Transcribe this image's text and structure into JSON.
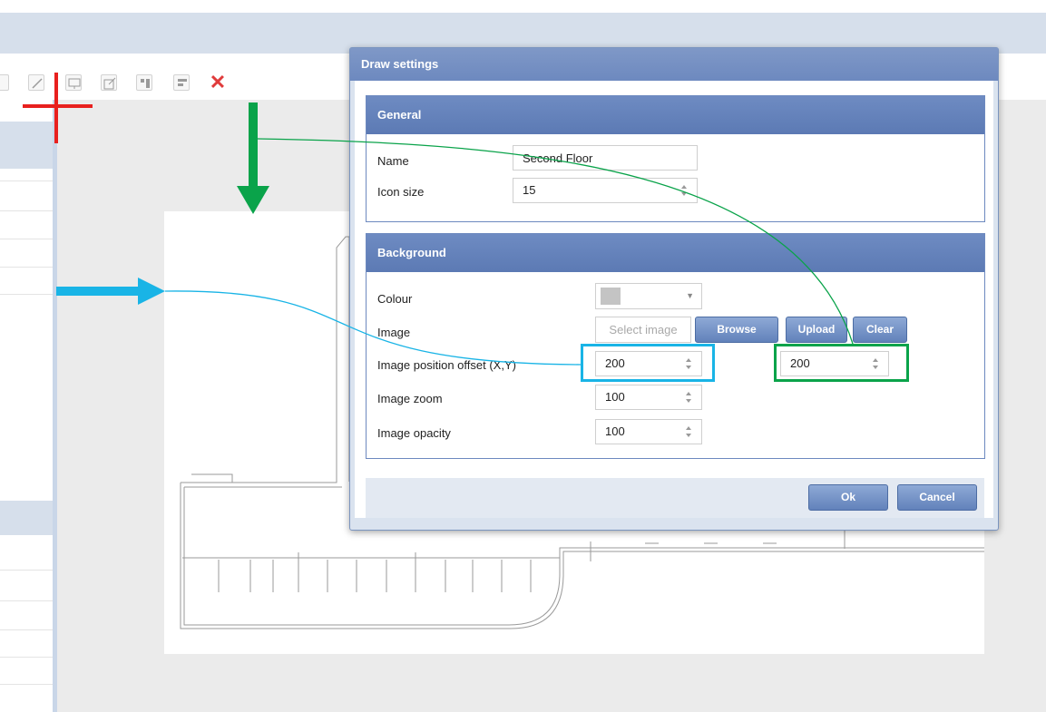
{
  "toolbar": {
    "icons": [
      "edit-line-icon",
      "monitor-icon",
      "edit-icon",
      "align-icon",
      "layout-icon",
      "delete-icon"
    ],
    "close_glyph": "✕",
    "close_color": "#e03b3b"
  },
  "dialog": {
    "title": "Draw settings",
    "general": {
      "heading": "General",
      "name_label": "Name",
      "name_value": "Second Floor",
      "icon_size_label": "Icon size",
      "icon_size_value": "15"
    },
    "background": {
      "heading": "Background",
      "colour_label": "Colour",
      "colour_value": "#c4c4c4",
      "image_label": "Image",
      "image_placeholder": "Select image",
      "browse_label": "Browse",
      "upload_label": "Upload",
      "clear_label": "Clear",
      "offset_label": "Image position offset (X,Y)",
      "offset_x": "200",
      "offset_y": "200",
      "zoom_label": "Image zoom",
      "zoom_value": "100",
      "opacity_label": "Image opacity",
      "opacity_value": "100"
    },
    "ok_label": "Ok",
    "cancel_label": "Cancel"
  },
  "annotations": {
    "crosshair_color": "#e8201e",
    "green_color": "#0aa34a",
    "blue_color": "#19b4e6"
  }
}
